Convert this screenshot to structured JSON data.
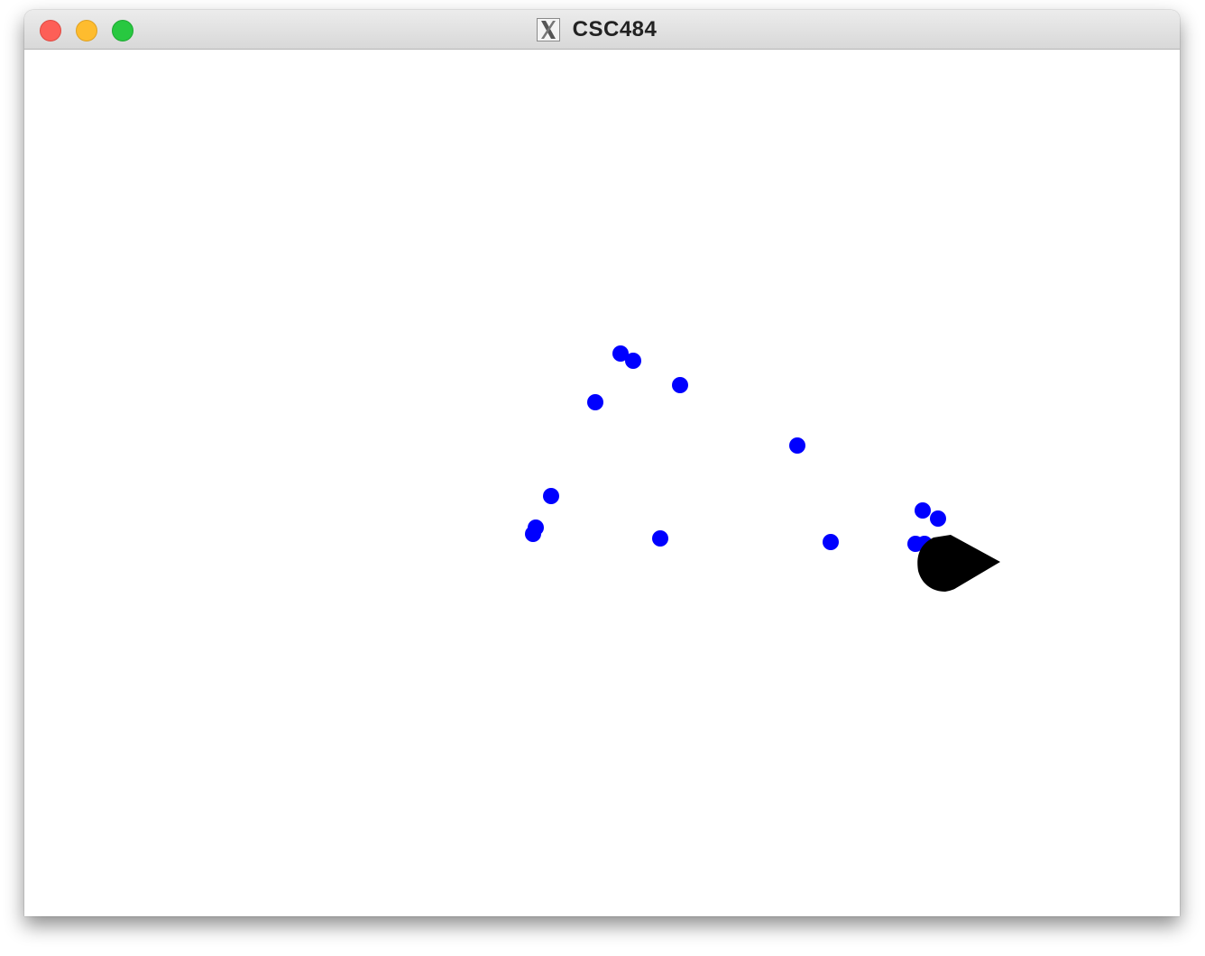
{
  "window": {
    "title": "CSC484",
    "title_icon": "x11-icon"
  },
  "scene": {
    "background_color": "#ffffff",
    "dot_color": "#0000ff",
    "agent_color": "#000000",
    "agent_heading": "right"
  }
}
